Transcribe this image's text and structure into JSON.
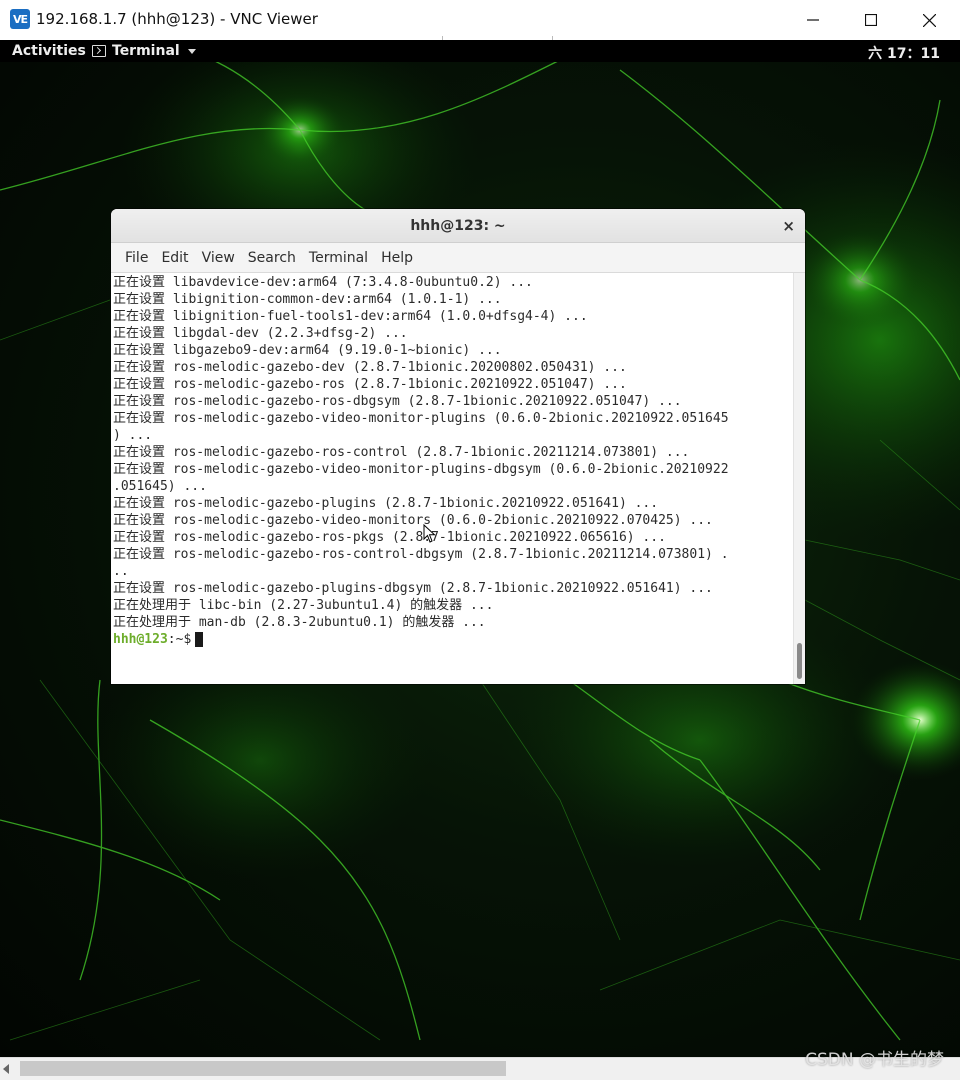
{
  "vnc_window": {
    "logo_text": "VE",
    "title": "192.168.1.7 (hhh@123) - VNC Viewer",
    "controls": [
      "minimize-icon",
      "maximize-icon",
      "close-icon"
    ]
  },
  "gnome_bar": {
    "activities_label": "Activities",
    "app_menu_label": "Terminal",
    "clock": "六 17：11"
  },
  "terminal": {
    "title": "hhh@123: ~",
    "close_glyph": "×",
    "menu": [
      "File",
      "Edit",
      "View",
      "Search",
      "Terminal",
      "Help"
    ],
    "lines": [
      "正在设置 libavdevice-dev:arm64 (7:3.4.8-0ubuntu0.2) ...",
      "正在设置 libignition-common-dev:arm64 (1.0.1-1) ...",
      "正在设置 libignition-fuel-tools1-dev:arm64 (1.0.0+dfsg4-4) ...",
      "正在设置 libgdal-dev (2.2.3+dfsg-2) ...",
      "正在设置 libgazebo9-dev:arm64 (9.19.0-1~bionic) ...",
      "正在设置 ros-melodic-gazebo-dev (2.8.7-1bionic.20200802.050431) ...",
      "正在设置 ros-melodic-gazebo-ros (2.8.7-1bionic.20210922.051047) ...",
      "正在设置 ros-melodic-gazebo-ros-dbgsym (2.8.7-1bionic.20210922.051047) ...",
      "正在设置 ros-melodic-gazebo-video-monitor-plugins (0.6.0-2bionic.20210922.051645",
      ") ...",
      "正在设置 ros-melodic-gazebo-ros-control (2.8.7-1bionic.20211214.073801) ...",
      "正在设置 ros-melodic-gazebo-video-monitor-plugins-dbgsym (0.6.0-2bionic.20210922",
      ".051645) ...",
      "正在设置 ros-melodic-gazebo-plugins (2.8.7-1bionic.20210922.051641) ...",
      "正在设置 ros-melodic-gazebo-video-monitors (0.6.0-2bionic.20210922.070425) ...",
      "正在设置 ros-melodic-gazebo-ros-pkgs (2.8.7-1bionic.20210922.065616) ...",
      "正在设置 ros-melodic-gazebo-ros-control-dbgsym (2.8.7-1bionic.20211214.073801) .",
      "..",
      "正在设置 ros-melodic-gazebo-plugins-dbgsym (2.8.7-1bionic.20210922.051641) ...",
      "正在处理用于 libc-bin (2.27-3ubuntu1.4) 的触发器 ...",
      "正在处理用于 man-db (2.8.3-2ubuntu0.1) 的触发器 ..."
    ],
    "prompt": {
      "user_host": "hhh@123",
      "separator": ":",
      "path_symbol": "~$"
    }
  },
  "watermark": "CSDN @书生的梦",
  "colors": {
    "prompt_green": "#6dad2b",
    "wallpaper_glow": "#3dff1a",
    "vnc_logo": "#1b6ec2"
  }
}
